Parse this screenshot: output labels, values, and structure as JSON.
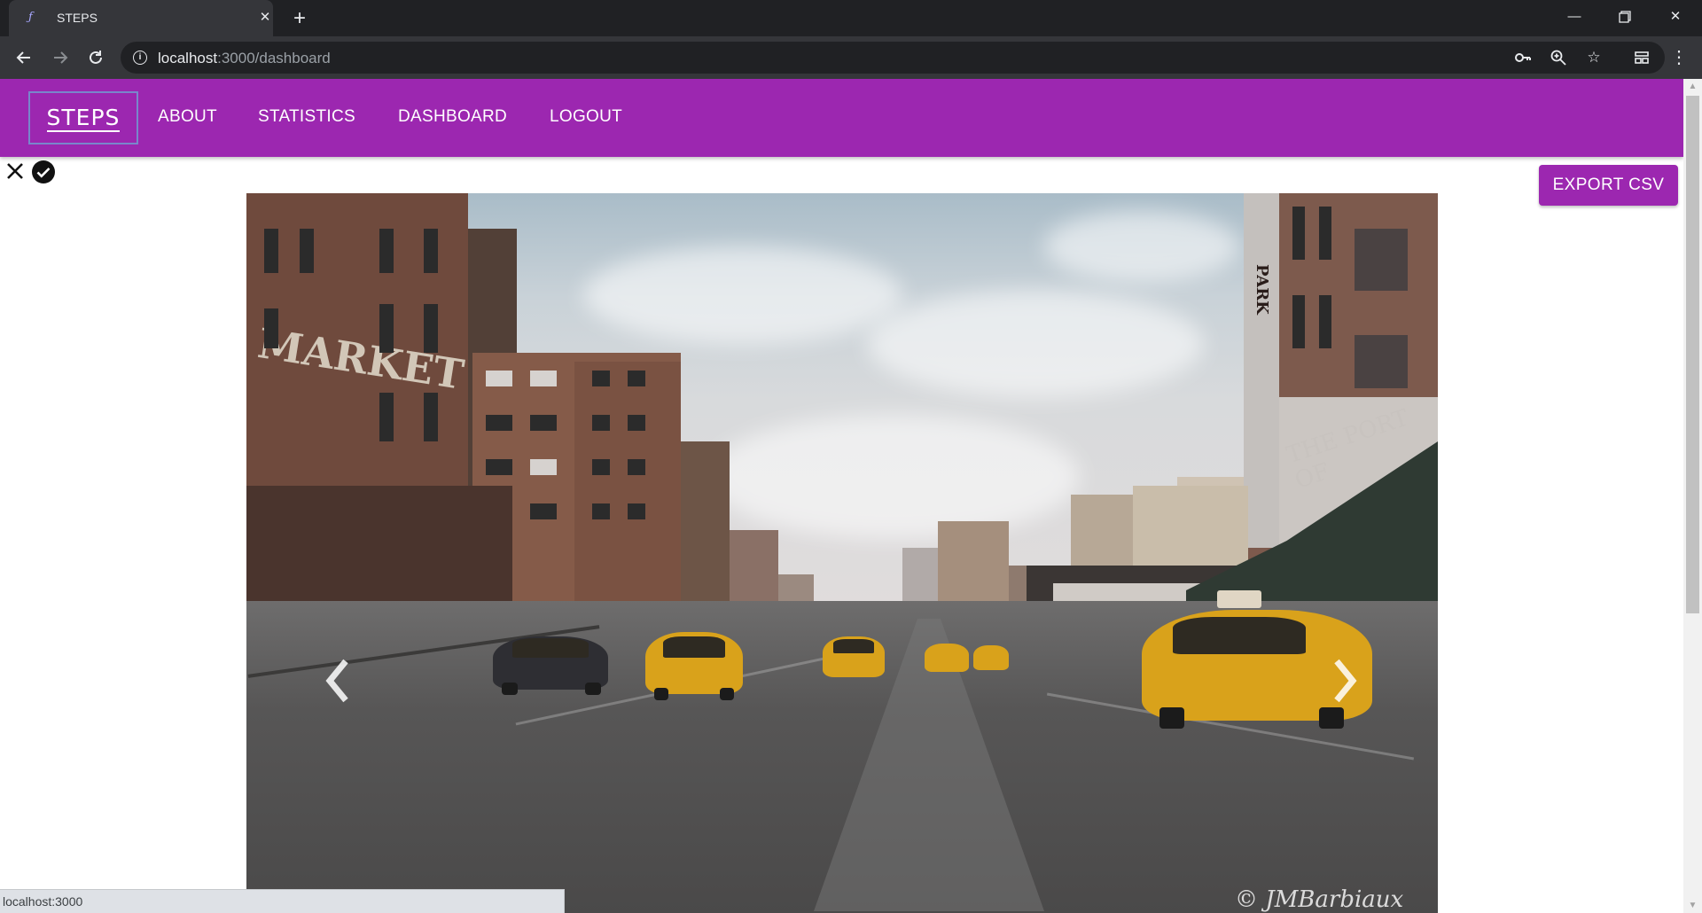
{
  "browser": {
    "tab_title": "STEPS",
    "url_host": "localhost",
    "url_path": ":3000/dashboard",
    "status_url": "localhost:3000"
  },
  "appbar": {
    "brand": "STEPS",
    "links": [
      "ABOUT",
      "STATISTICS",
      "DASHBOARD",
      "LOGOUT"
    ]
  },
  "actions": {
    "export_label": "EXPORT CSV"
  },
  "carousel": {
    "image_watermark": "© JMBarbiaux",
    "sign_market": "MARKET",
    "sign_port": "THE PORT OF",
    "sign_park": "PARK"
  },
  "colors": {
    "primary": "#9c27b0",
    "brand_outline": "#7986cb"
  }
}
